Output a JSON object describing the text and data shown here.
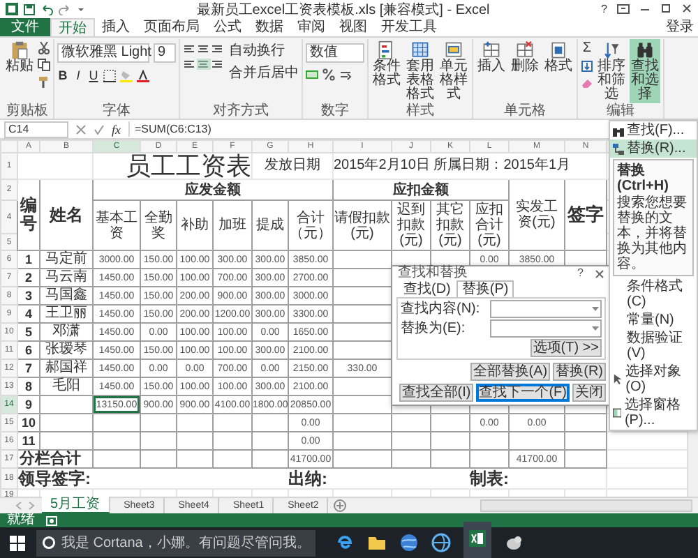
{
  "window": {
    "title": "最新员工excel工资表模板.xls [兼容模式] - Excel",
    "help": "?"
  },
  "menu_tabs": [
    {
      "label": "文件",
      "kind": "file",
      "selected": false
    },
    {
      "label": "开始",
      "kind": "tab",
      "selected": true
    },
    {
      "label": "插入",
      "kind": "tab",
      "selected": false
    },
    {
      "label": "页面布局",
      "kind": "tab",
      "selected": false
    },
    {
      "label": "公式",
      "kind": "tab",
      "selected": false
    },
    {
      "label": "数据",
      "kind": "tab",
      "selected": false
    },
    {
      "label": "审阅",
      "kind": "tab",
      "selected": false
    },
    {
      "label": "视图",
      "kind": "tab",
      "selected": false
    },
    {
      "label": "开发工具",
      "kind": "tab",
      "selected": false
    }
  ],
  "sign_in": "登录",
  "ribbon": {
    "groups": [
      {
        "kind": "clipboard",
        "label": "剪贴板",
        "buttons": [
          {
            "label": "粘贴",
            "kind": "paste",
            "selected": false
          }
        ]
      },
      {
        "kind": "font",
        "label": "字体",
        "font": "微软雅黑 Light",
        "size": "9",
        "styles": [
          "B",
          "I",
          "U"
        ]
      },
      {
        "kind": "align",
        "label": "对齐方式",
        "options": [
          "自动换行",
          "合并后居中"
        ]
      },
      {
        "kind": "number",
        "label": "数字",
        "format": "数值"
      },
      {
        "kind": "buttons",
        "label": "样式",
        "buttons": [
          {
            "label": "条件格式",
            "kind": "cond",
            "selected": false
          },
          {
            "label": "套用表格格式",
            "kind": "table",
            "selected": false
          },
          {
            "label": "单元格样式",
            "kind": "cellstyle",
            "selected": false
          }
        ]
      },
      {
        "kind": "buttons",
        "label": "单元格",
        "buttons": [
          {
            "label": "插入",
            "kind": "insert",
            "selected": false
          },
          {
            "label": "删除",
            "kind": "delete",
            "selected": false
          },
          {
            "label": "格式",
            "kind": "format",
            "selected": false
          }
        ]
      },
      {
        "kind": "edit",
        "label": "编辑",
        "sum": "Σ",
        "buttons": [
          {
            "label": "排序和筛选",
            "kind": "sort",
            "selected": false
          },
          {
            "label": "查找和选择",
            "kind": "find",
            "selected": true
          }
        ]
      }
    ]
  },
  "formula_bar": {
    "name_box": "C14",
    "fx": "fx",
    "formula": "=SUM(C6:C13)"
  },
  "find_menu": {
    "items": [
      {
        "label": "查找(F)...",
        "kind": "find",
        "selected": false
      },
      {
        "label": "替换(R)...",
        "kind": "replace",
        "selected": true
      },
      {
        "label": "条件格式(C)",
        "kind": "plain",
        "selected": false
      },
      {
        "label": "常量(N)",
        "kind": "plain",
        "selected": false
      },
      {
        "label": "数据验证(V)",
        "kind": "plain",
        "selected": false
      },
      {
        "label": "选择对象(O)",
        "kind": "pointer",
        "selected": false
      },
      {
        "label": "选择窗格(P)...",
        "kind": "pane",
        "selected": false
      }
    ],
    "tooltip": {
      "title": "替换 (Ctrl+H)",
      "text": "搜索您想要替换的文本，并将替换为其他内容。"
    }
  },
  "sheet": {
    "columns": [
      {
        "letter": "A",
        "selected": false
      },
      {
        "letter": "B",
        "selected": false
      },
      {
        "letter": "C",
        "selected": true
      },
      {
        "letter": "D",
        "selected": false
      },
      {
        "letter": "E",
        "selected": false
      },
      {
        "letter": "F",
        "selected": false
      },
      {
        "letter": "G",
        "selected": false
      },
      {
        "letter": "H",
        "selected": false
      },
      {
        "letter": "I",
        "selected": false
      },
      {
        "letter": "J",
        "selected": false
      },
      {
        "letter": "K",
        "selected": false
      },
      {
        "letter": "L",
        "selected": false
      },
      {
        "letter": "M",
        "selected": false
      },
      {
        "letter": "N",
        "selected": false
      }
    ],
    "title_row": {
      "num": "1",
      "title": "员工工资表",
      "date_label": "发放日期",
      "date_text": "2015年2月10日 所属日期：2015年1月"
    },
    "header": {
      "nums": [
        "2",
        "4",
        "5"
      ],
      "id": "编号",
      "name": "姓名",
      "earn_group": "应发金额",
      "earn_cols": [
        "基本工资",
        "全勤奖",
        "补助",
        "加班",
        "提成",
        "合计（元）"
      ],
      "deduct_group": "应扣金额",
      "deduct_cols": [
        "请假扣款(元)",
        "迟到扣款(元)",
        "其它扣款(元)",
        "应扣合计(元)"
      ],
      "net": "实发工资(元)",
      "sign": "签字"
    },
    "rows": [
      {
        "num": "6",
        "selected": false,
        "cells": [
          "1",
          "马定前",
          "3000.00",
          "150.00",
          "100.00",
          "300.00",
          "300.00",
          "3850.00",
          null,
          null,
          null,
          "0.00",
          "3850.00",
          null
        ]
      },
      {
        "num": "7",
        "selected": false,
        "cells": [
          "2",
          "马云南",
          "1450.00",
          "150.00",
          "100.00",
          "700.00",
          "300.00",
          "2700.00",
          null,
          null,
          null,
          null,
          null,
          null
        ]
      },
      {
        "num": "8",
        "selected": false,
        "cells": [
          "3",
          "马国鑫",
          "1450.00",
          "150.00",
          "200.00",
          "900.00",
          "300.00",
          "3000.00",
          null,
          null,
          null,
          null,
          null,
          null
        ]
      },
      {
        "num": "9",
        "selected": false,
        "cells": [
          "4",
          "王卫丽",
          "1450.00",
          "150.00",
          "200.00",
          "1200.00",
          "300.00",
          "3300.00",
          null,
          null,
          null,
          null,
          null,
          null
        ]
      },
      {
        "num": "10",
        "selected": false,
        "cells": [
          "5",
          "邓潇",
          "1450.00",
          "0.00",
          "100.00",
          "100.00",
          "0.00",
          "1650.00",
          null,
          null,
          null,
          null,
          null,
          null
        ]
      },
      {
        "num": "11",
        "selected": false,
        "cells": [
          "6",
          "张瑷琴",
          "1450.00",
          "150.00",
          "100.00",
          "100.00",
          "300.00",
          "2100.00",
          null,
          null,
          null,
          null,
          null,
          null
        ]
      },
      {
        "num": "12",
        "selected": false,
        "cells": [
          "7",
          "郝国祥",
          "1450.00",
          "0.00",
          "0.00",
          "700.00",
          "0.00",
          "2150.00",
          "330.00",
          null,
          null,
          null,
          null,
          null
        ]
      },
      {
        "num": "13",
        "selected": false,
        "cells": [
          "8",
          "毛阳",
          "1450.00",
          "150.00",
          "100.00",
          "100.00",
          "300.00",
          "2100.00",
          null,
          null,
          null,
          null,
          null,
          null
        ]
      },
      {
        "num": "14",
        "selected": true,
        "cells": [
          "9",
          null,
          "13150.00",
          "900.00",
          "900.00",
          "4100.00",
          "1800.00",
          "20850.00",
          null,
          null,
          null,
          null,
          null,
          null
        ]
      },
      {
        "num": "15",
        "selected": false,
        "cells": [
          "10",
          null,
          null,
          null,
          null,
          null,
          null,
          "0.00",
          null,
          null,
          null,
          "0.00",
          "0.00",
          null
        ]
      },
      {
        "num": "16",
        "selected": false,
        "cells": [
          "11",
          null,
          null,
          null,
          null,
          null,
          null,
          "0.00",
          null,
          null,
          null,
          null,
          null,
          null
        ]
      }
    ],
    "total_row": {
      "num": "17",
      "label": "分栏合计",
      "cells": [
        null,
        null,
        null,
        null,
        null,
        "41700.00",
        null,
        null,
        null,
        null,
        "41700.00",
        null
      ]
    },
    "footer_row": {
      "num": "18",
      "labels": [
        "领导签字:",
        "出纳:",
        "制表:"
      ]
    },
    "empty_rows": [
      "19"
    ]
  },
  "dialog": {
    "title": "查找和替换",
    "help": "?",
    "tabs": [
      {
        "label": "查找(D)",
        "selected": false
      },
      {
        "label": "替换(P)",
        "selected": true
      }
    ],
    "fields": [
      {
        "label": "查找内容(N):"
      },
      {
        "label": "替换为(E):"
      }
    ],
    "options_button": "选项(T) >>",
    "buttons": [
      {
        "label": "全部替换(A)",
        "default": false
      },
      {
        "label": "替换(R)",
        "default": false
      },
      {
        "label": "查找全部(I)",
        "default": false
      },
      {
        "label": "查找下一个(F)",
        "default": true
      },
      {
        "label": "关闭",
        "default": false
      }
    ]
  },
  "sheet_tabs": [
    {
      "label": "5月工资",
      "selected": true
    },
    {
      "label": "Sheet3",
      "selected": false
    },
    {
      "label": "Sheet4",
      "selected": false
    },
    {
      "label": "Sheet1",
      "selected": false
    },
    {
      "label": "Sheet2",
      "selected": false
    }
  ],
  "status_bar": {
    "text": "就绪"
  },
  "taskbar": {
    "search_placeholder": "我是 Cortana，小娜。有问题尽管问我。"
  }
}
